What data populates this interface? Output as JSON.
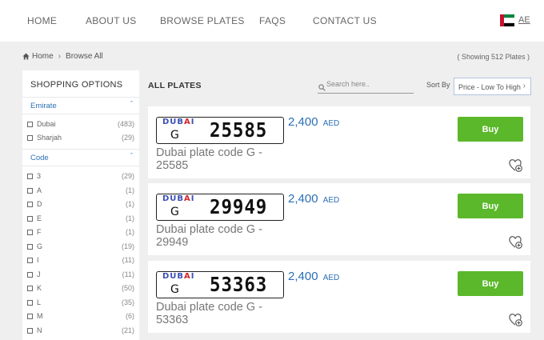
{
  "nav": {
    "items": [
      "HOME",
      "ABOUT US",
      "BROWSE PLATES",
      "FAQS",
      "CONTACT US"
    ],
    "lang": "AE"
  },
  "breadcrumb": {
    "home": "Home",
    "current": "Browse All"
  },
  "showing": "( Showing 512 Plates )",
  "sidebar": {
    "title": "SHOPPING OPTIONS",
    "emirate": {
      "heading": "Emirate",
      "options": [
        {
          "label": "Dubai",
          "count": "(483)"
        },
        {
          "label": "Sharjah",
          "count": "(29)"
        }
      ]
    },
    "code": {
      "heading": "Code",
      "options": [
        {
          "label": "3",
          "count": "(29)"
        },
        {
          "label": "A",
          "count": "(1)"
        },
        {
          "label": "D",
          "count": "(1)"
        },
        {
          "label": "E",
          "count": "(1)"
        },
        {
          "label": "F",
          "count": "(1)"
        },
        {
          "label": "G",
          "count": "(19)"
        },
        {
          "label": "I",
          "count": "(11)"
        },
        {
          "label": "J",
          "count": "(11)"
        },
        {
          "label": "K",
          "count": "(50)"
        },
        {
          "label": "L",
          "count": "(35)"
        },
        {
          "label": "M",
          "count": "(6)"
        },
        {
          "label": "N",
          "count": "(21)"
        }
      ]
    }
  },
  "main": {
    "heading": "ALL PLATES",
    "search_placeholder": "Search here..",
    "sort_label": "Sort By",
    "sort_value": "Price - Low To High"
  },
  "plates": [
    {
      "emirate": "DUBAI",
      "code": "G",
      "number": "25585",
      "price": "2,400",
      "currency": "AED",
      "title": "Dubai plate code G - 25585",
      "buy": "Buy"
    },
    {
      "emirate": "DUBAI",
      "code": "G",
      "number": "29949",
      "price": "2,400",
      "currency": "AED",
      "title": "Dubai plate code G - 29949",
      "buy": "Buy"
    },
    {
      "emirate": "DUBAI",
      "code": "G",
      "number": "53363",
      "price": "2,400",
      "currency": "AED",
      "title": "Dubai plate code G - 53363",
      "buy": "Buy"
    }
  ],
  "colors": {
    "accent": "#2b6fb6",
    "buy": "#5bb82a"
  }
}
